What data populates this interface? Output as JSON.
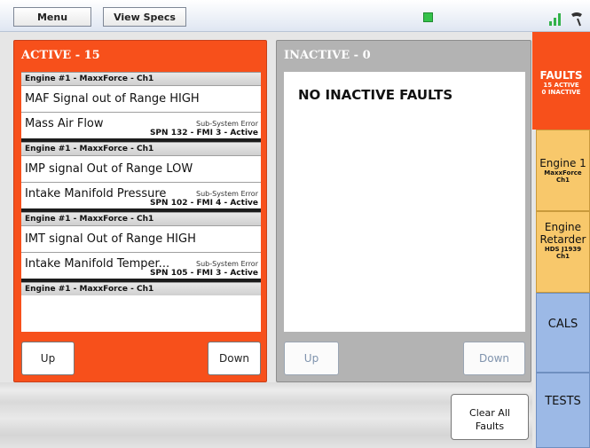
{
  "topbar": {
    "menu_label": "Menu",
    "specs_label": "View Specs"
  },
  "active_panel": {
    "title": "ACTIVE - 15",
    "faults": [
      {
        "header": "Engine #1 - MaxxForce - Ch1",
        "description": "MAF Signal out of Range HIGH",
        "subsystem": "Mass Air Flow",
        "type": "Sub-System Error",
        "code": "SPN 132 - FMI 3 - Active"
      },
      {
        "header": "Engine #1 - MaxxForce - Ch1",
        "description": "IMP signal Out of Range LOW",
        "subsystem": "Intake Manifold Pressure",
        "type": "Sub-System Error",
        "code": "SPN 102 - FMI 4 - Active"
      },
      {
        "header": "Engine #1 - MaxxForce - Ch1",
        "description": "IMT signal Out of Range HIGH",
        "subsystem": "Intake Manifold Temper...",
        "type": "Sub-System Error",
        "code": "SPN 105 - FMI 3 - Active"
      },
      {
        "header": "Engine #1 - MaxxForce - Ch1"
      }
    ],
    "up_label": "Up",
    "down_label": "Down"
  },
  "inactive_panel": {
    "title": "INACTIVE - 0",
    "message": "NO INACTIVE FAULTS",
    "up_label": "Up",
    "down_label": "Down"
  },
  "clear_button": {
    "line1": "Clear All",
    "line2": "Faults"
  },
  "tabs": {
    "faults": {
      "title": "FAULTS",
      "line1": "15 ACTIVE",
      "line2": "0 INACTIVE"
    },
    "engine1": {
      "title": "Engine 1",
      "line1": "MaxxForce",
      "line2": "Ch1"
    },
    "retarder": {
      "title1": "Engine",
      "title2": "Retarder",
      "line1": "HDS J1939",
      "line2": "Ch1"
    },
    "cals": {
      "title": "CALS"
    },
    "tests": {
      "title": "TESTS"
    }
  },
  "colors": {
    "active": "#f7501b",
    "inactive": "#b3b3b3",
    "engine_tab": "#f8c86b",
    "blue_tab": "#9cb9e6"
  },
  "icons": [
    "status-green-icon",
    "signal-bars-icon",
    "phone-icon"
  ]
}
